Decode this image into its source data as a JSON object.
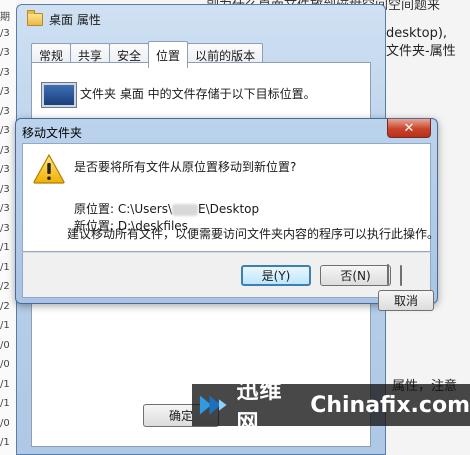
{
  "background": {
    "line1": "副为什么桌面文件放到磁盘空间空间题来",
    "line2": "desktop),",
    "line3": "文件夹-属性",
    "line4": "属性，注意",
    "left_col": [
      "期",
      "/3",
      "/3",
      "/3",
      "/3",
      "/3",
      "/3",
      "/3",
      "/3",
      "/3",
      "/3",
      "/3",
      "/1",
      "/1",
      "/2",
      "/2",
      "/1",
      "/0",
      "/0",
      "/1",
      "/1",
      "/0",
      "/1"
    ]
  },
  "properties_window": {
    "title": "桌面 属性",
    "tabs": [
      "常规",
      "共享",
      "安全",
      "位置",
      "以前的版本"
    ],
    "active_tab": 3,
    "panel_text": "文件夹 桌面 中的文件存储于以下目标位置。",
    "ok_label": "确定"
  },
  "dialog": {
    "title": "移动文件夹",
    "close_label": "✕",
    "question": "是否要将所有文件从原位置移动到新位置?",
    "original_label": "原位置:",
    "original_prefix": "C:\\Users\\",
    "original_suffix": "E\\Desktop",
    "new_label": "新位置:",
    "new_value": "D:\\deskfiles",
    "advice": "建议移动所有文件，以便需要访问文件夹内容的程序可以执行此操作。",
    "buttons": {
      "yes": "是(Y)",
      "no": "否(N)",
      "cancel": "取消"
    }
  },
  "watermark": {
    "cn": "迅维网",
    "en": "Chinafix.com"
  }
}
